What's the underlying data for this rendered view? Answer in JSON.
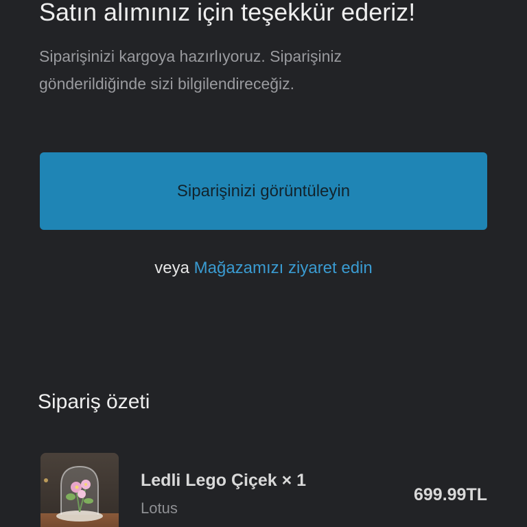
{
  "header": {
    "title": "Satın alımınız için teşekkür ederiz!",
    "subtitle": "Siparişinizi kargoya hazırlıyoruz. Siparişiniz gönderildiğinde sizi bilgilendireceğiz."
  },
  "actions": {
    "view_order_label": "Siparişinizi görüntüleyin",
    "or_text": "veya",
    "visit_store_label": "Mağazamızı ziyaret edin"
  },
  "summary": {
    "title": "Sipariş özeti",
    "items": [
      {
        "name": "Ledli Lego Çiçek × 1",
        "variant": "Lotus",
        "price": "699.99TL",
        "image_icon": "product-thumbnail"
      }
    ]
  },
  "colors": {
    "background": "#222326",
    "accent_button": "#1f85b5",
    "link": "#3a9bd1"
  }
}
